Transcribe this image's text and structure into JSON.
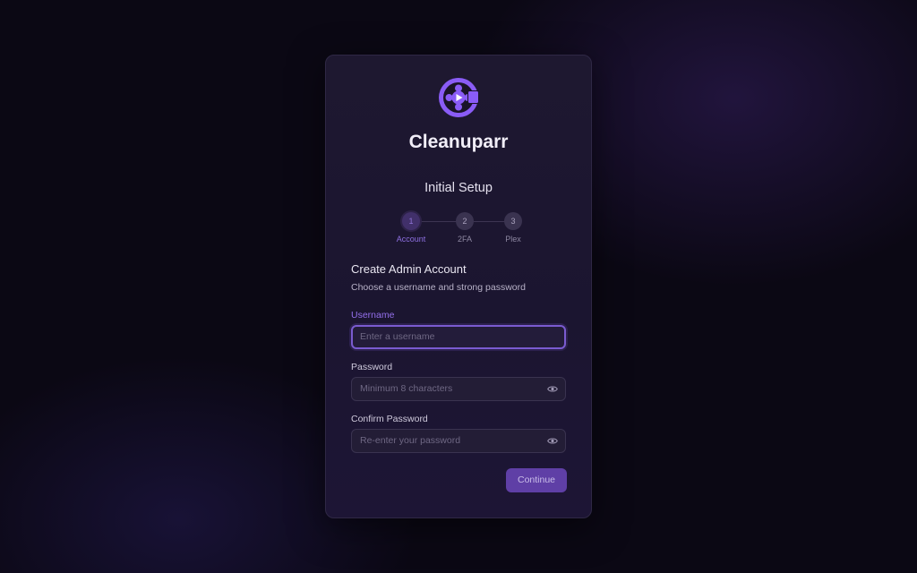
{
  "app": {
    "name": "Cleanuparr"
  },
  "setup": {
    "title": "Initial Setup",
    "steps": [
      {
        "number": "1",
        "label": "Account",
        "active": true
      },
      {
        "number": "2",
        "label": "2FA",
        "active": false
      },
      {
        "number": "3",
        "label": "Plex",
        "active": false
      }
    ]
  },
  "form": {
    "heading": "Create Admin Account",
    "description": "Choose a username and strong password",
    "username": {
      "label": "Username",
      "placeholder": "Enter a username",
      "value": ""
    },
    "password": {
      "label": "Password",
      "placeholder": "Minimum 8 characters",
      "value": ""
    },
    "confirm": {
      "label": "Confirm Password",
      "placeholder": "Re-enter your password",
      "value": ""
    },
    "continue_label": "Continue"
  },
  "icons": {
    "logo": "film-reel-camera-icon",
    "show_password": "eye-icon"
  },
  "colors": {
    "accent": "#8a5cf6",
    "button": "#5f3fa6",
    "card": "#1d1731",
    "background": "#0b0814"
  }
}
